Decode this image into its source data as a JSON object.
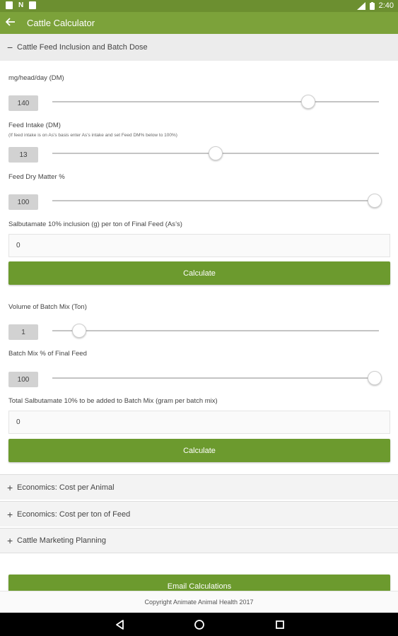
{
  "status_bar": {
    "left_icons": [
      "sd-card-icon",
      "n-notification-icon",
      "download-notification-icon"
    ],
    "time": "2:40"
  },
  "app_bar": {
    "title": "Cattle Calculator"
  },
  "feed_section": {
    "header": "Cattle Feed Inclusion and Batch Dose",
    "toggle_symbol": "−",
    "fields": [
      {
        "label": "mg/head/day (DM)",
        "value": "140",
        "slider_fraction": 0.79
      },
      {
        "label": "Feed Intake (DM)",
        "note": "(If feed intake is on As’s basis enter As’s intake and set Feed DM% below to 100%)",
        "value": "13",
        "slider_fraction": 0.5
      },
      {
        "label": "Feed Dry Matter %",
        "value": "100",
        "slider_fraction": 1.0
      }
    ],
    "result1": {
      "label": "Salbutamate 10% inclusion (g) per ton of Final Feed (As’s)",
      "value": "0"
    },
    "calculate_label": "Calculate",
    "batch_fields": [
      {
        "label": "Volume of Batch Mix (Ton)",
        "value": "1",
        "slider_fraction": 0.07
      },
      {
        "label": "Batch Mix % of Final Feed",
        "value": "100",
        "slider_fraction": 1.0
      }
    ],
    "result2": {
      "label": "Total Salbutamate 10% to be added to Batch Mix (gram per batch mix)",
      "value": "0"
    },
    "calculate2_label": "Calculate"
  },
  "collapsed_sections": [
    {
      "symbol": "+",
      "label": "Economics: Cost per Animal"
    },
    {
      "symbol": "+",
      "label": "Economics: Cost per ton of Feed"
    },
    {
      "symbol": "+",
      "label": "Cattle Marketing Planning"
    }
  ],
  "email_button": "Email Calculations",
  "footer": "Copyright Animate Animal Health 2017",
  "colors": {
    "status_bar": "#6c8f30",
    "app_bar": "#7ca23a",
    "button": "#6c9a2e",
    "section_header": "#ececec"
  }
}
